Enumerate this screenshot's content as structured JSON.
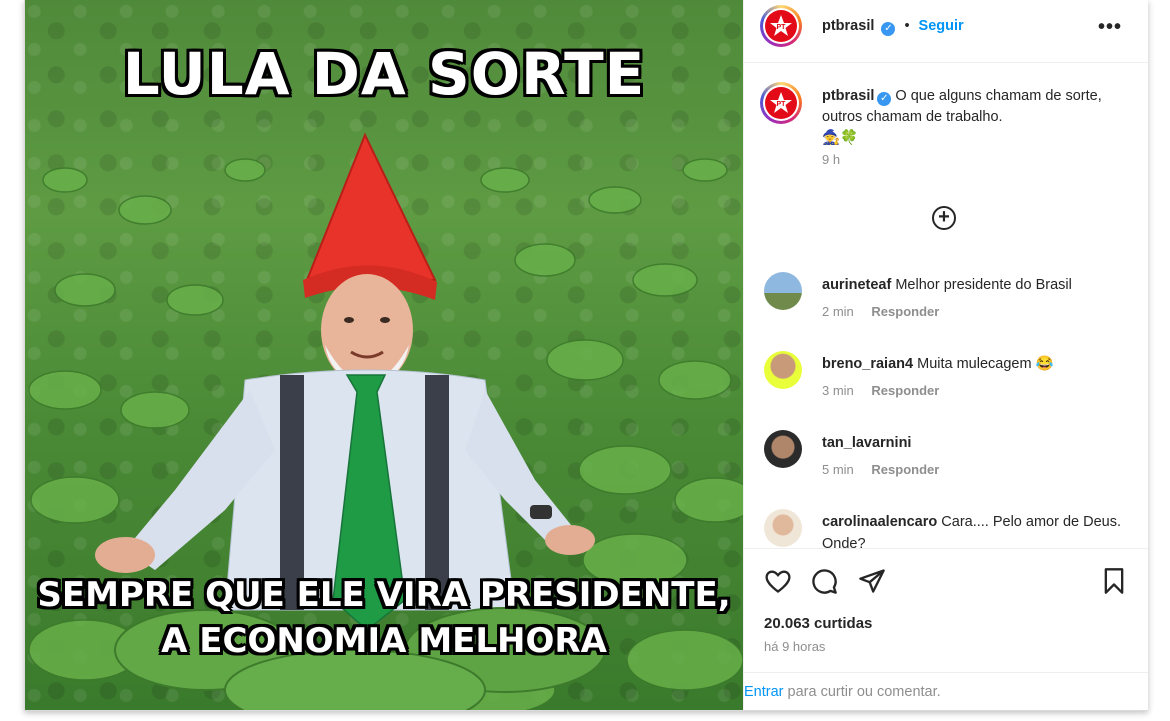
{
  "image": {
    "top_text": "LULA DA SORTE",
    "bottom_text_line1": "SEMPRE QUE ELE VIRA PRESIDENTE,",
    "bottom_text_line2": "A ECONOMIA MELHORA"
  },
  "header": {
    "username": "ptbrasil",
    "separator": "•",
    "follow_label": "Seguir",
    "more_icon": "more-options-icon"
  },
  "caption": {
    "username": "ptbrasil",
    "text": "O que alguns chamam de sorte, outros chamam de trabalho.",
    "emojis": "🧙🍀",
    "time": "9 h"
  },
  "comments": [
    {
      "username": "aurineteaf",
      "text": "Melhor presidente do Brasil",
      "time": "2 min",
      "reply": "Responder"
    },
    {
      "username": "breno_raian4",
      "text": "Muita mulecagem 😂",
      "time": "3 min",
      "reply": "Responder"
    },
    {
      "username": "tan_lavarnini",
      "text": "",
      "time": "5 min",
      "reply": "Responder"
    },
    {
      "username": "carolinaalencaro",
      "text": "Cara.... Pelo amor de Deus. Onde?",
      "time": "",
      "reply": ""
    }
  ],
  "actions": {
    "likes": "20.063 curtidas",
    "ago": "há 9 horas"
  },
  "login": {
    "link": "Entrar",
    "text": " para curtir ou comentar."
  },
  "colors": {
    "accent": "#0095f6",
    "brand_red": "#e20b17",
    "muted": "#8e8e8e"
  }
}
